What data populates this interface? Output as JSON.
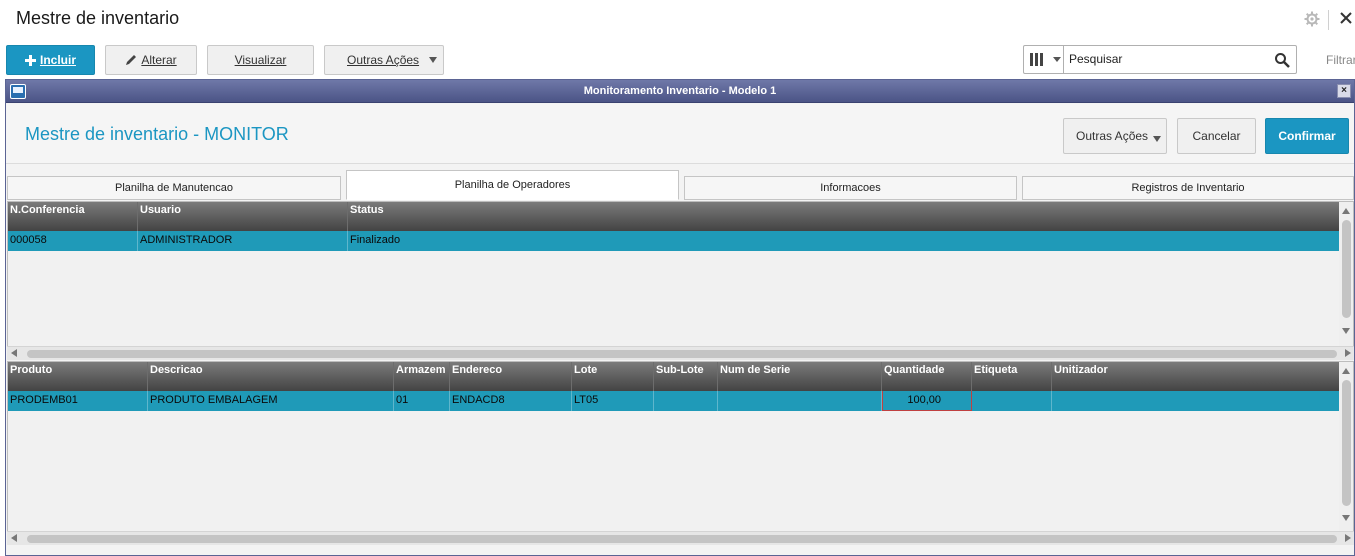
{
  "window": {
    "title": "Mestre de inventario"
  },
  "toolbar": {
    "incluir": "Incluir",
    "alterar": "Alterar",
    "visualizar": "Visualizar",
    "outras_acoes": "Outras Ações"
  },
  "search": {
    "placeholder": "Pesquisar",
    "filter_label": "Filtrar"
  },
  "modal": {
    "bar_title": "Monitoramento Inventario - Modelo 1",
    "close_glyph": "×",
    "heading": "Mestre de inventario - MONITOR",
    "buttons": {
      "outras_acoes": "Outras Ações",
      "cancelar": "Cancelar",
      "confirmar": "Confirmar"
    }
  },
  "tabs": [
    {
      "label": "Planilha de Manutencao"
    },
    {
      "label": "Planilha de Operadores"
    },
    {
      "label": "Informacoes"
    },
    {
      "label": "Registros de Inventario"
    }
  ],
  "operators_grid": {
    "columns": [
      "N.Conferencia",
      "Usuario",
      "Status"
    ],
    "rows": [
      [
        "000058",
        "ADMINISTRADOR",
        "Finalizado"
      ]
    ]
  },
  "products_grid": {
    "columns": [
      "Produto",
      "Descricao",
      "Armazem",
      "Endereco",
      "Lote",
      "Sub-Lote",
      "Num de Serie",
      "Quantidade",
      "Etiqueta",
      "Unitizador"
    ],
    "rows": [
      [
        "PRODEMB01",
        "PRODUTO EMBALAGEM",
        "01",
        "ENDACD8",
        "LT05",
        "",
        "",
        "100,00",
        "",
        ""
      ]
    ]
  },
  "colors": {
    "accent": "#1b96c2",
    "row_selected": "#1f9ab8",
    "modal_bar": "#5b6494"
  }
}
